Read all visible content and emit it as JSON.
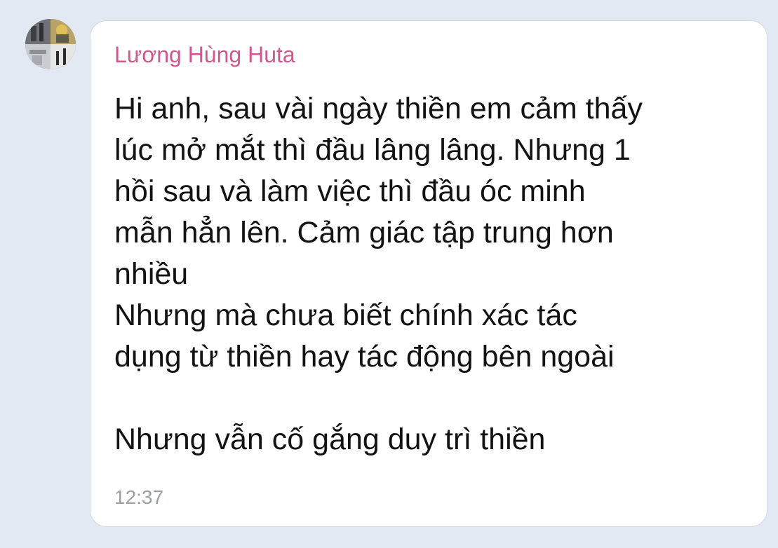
{
  "message": {
    "sender_name": "Lương Hùng Huta",
    "body": "Hi anh, sau vài ngày thiền em cảm thấy\nlúc mở mắt thì đầu lâng lâng. Nhưng 1\nhồi sau và làm việc thì đầu óc minh\nmẫn hẳn lên. Cảm giác tập trung hơn\nnhiều\nNhưng mà chưa biết chính xác tác\ndụng từ thiền hay tác động bên ngoài\n\nNhưng vẫn cố gắng duy trì thiền",
    "time": "12:37"
  },
  "colors": {
    "background": "#e2e9f2",
    "bubble": "#ffffff",
    "sender_name": "#d0588f",
    "message_text": "#131313",
    "timestamp": "#9a9fa6"
  }
}
